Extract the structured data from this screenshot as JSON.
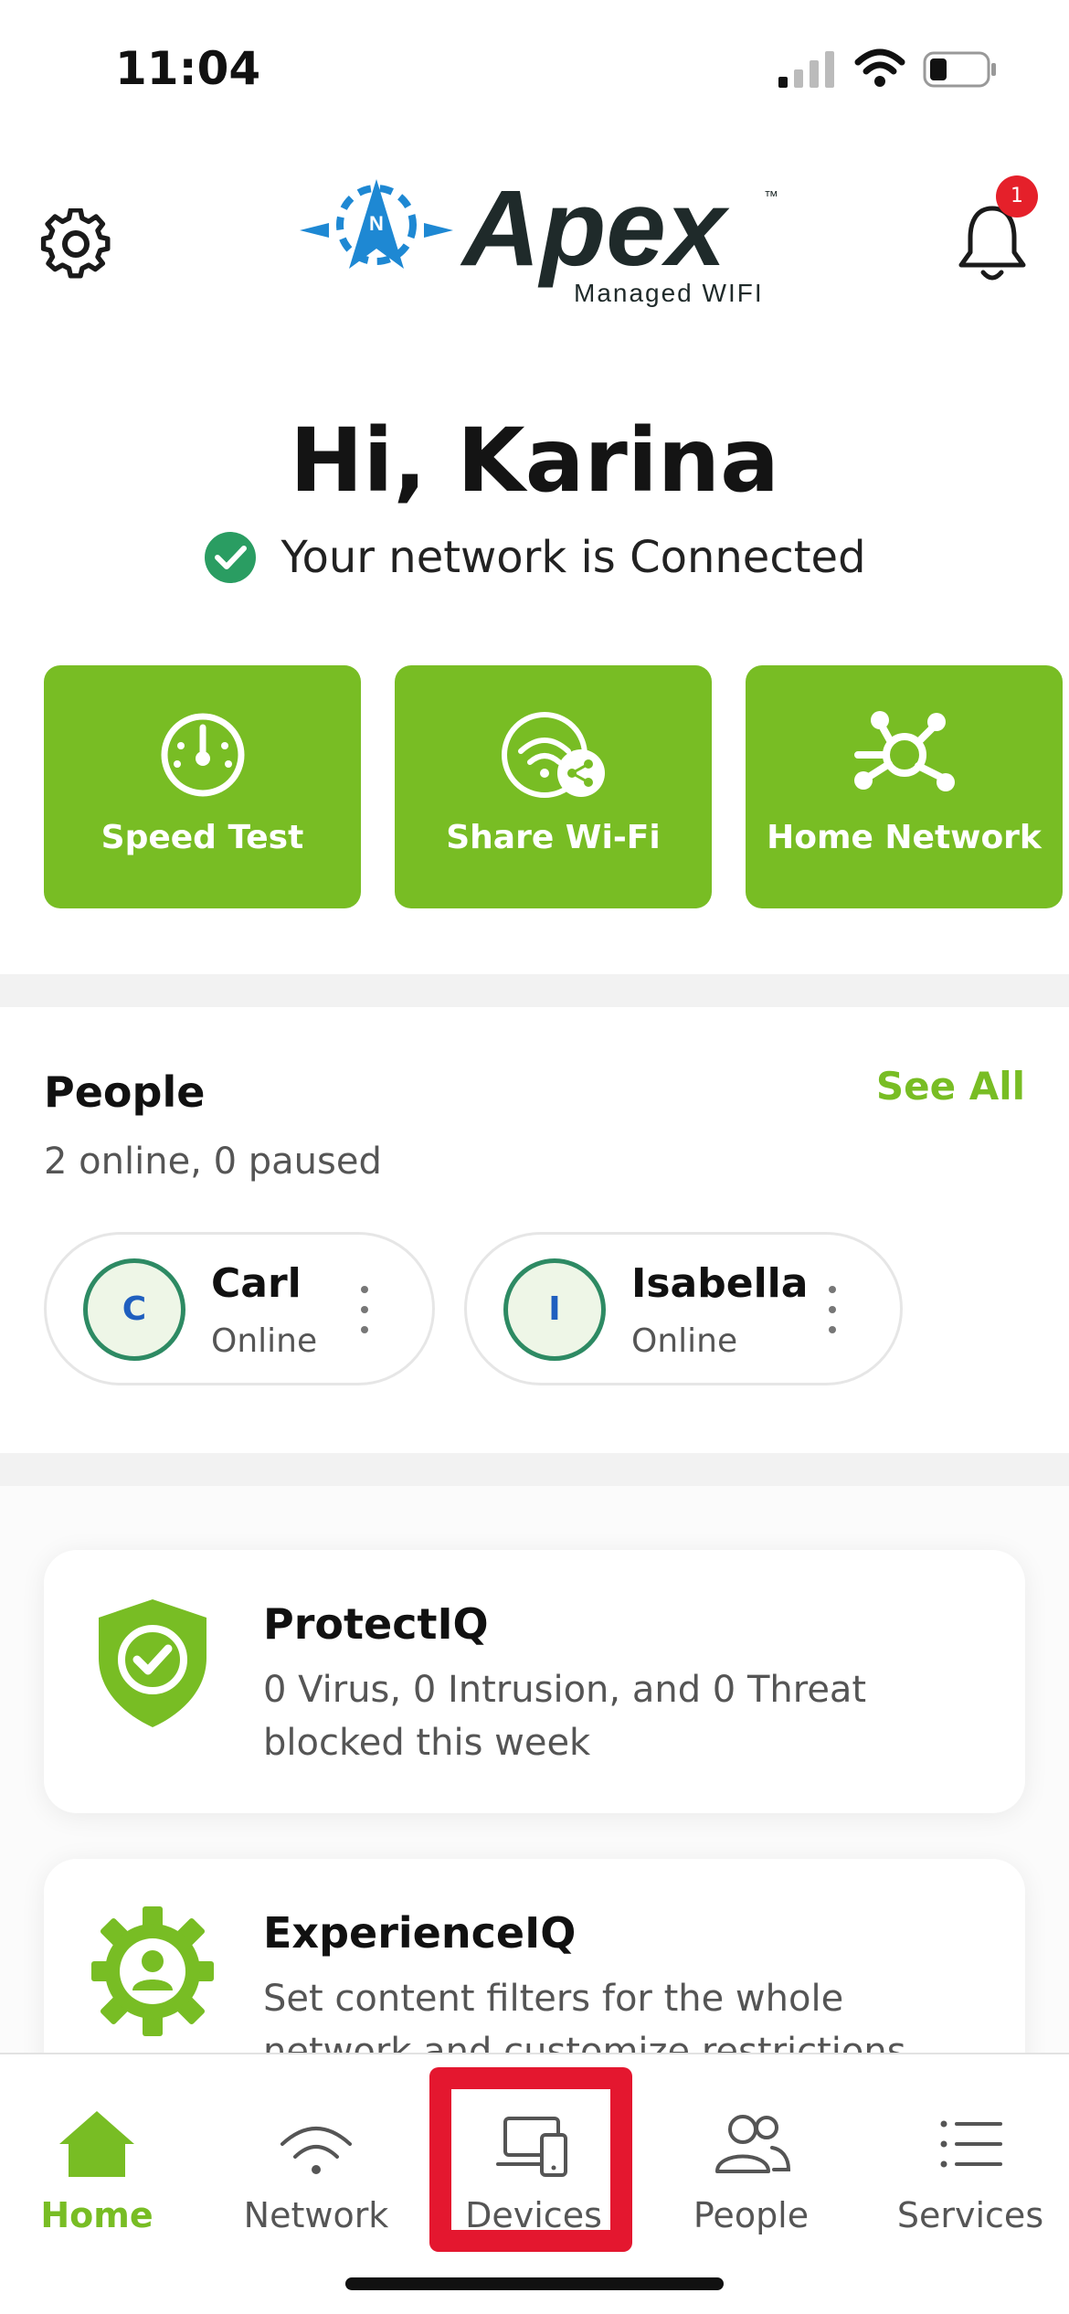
{
  "status_bar": {
    "time": "11:04"
  },
  "header": {
    "brand_name": "Apex",
    "brand_tagline": "Managed WIFI",
    "trademark": "™",
    "compass_letter": "N",
    "notification_count": "1"
  },
  "greeting": {
    "title": "Hi, Karina",
    "connection_text": "Your network is Connected"
  },
  "quick_actions": [
    {
      "label": "Speed Test",
      "icon": "speedometer-icon"
    },
    {
      "label": "Share Wi-Fi",
      "icon": "share-wifi-icon"
    },
    {
      "label": "Home Network",
      "icon": "network-hub-icon"
    }
  ],
  "people": {
    "title": "People",
    "see_all": "See All",
    "summary": "2 online, 0 paused",
    "members": [
      {
        "initial": "C",
        "name": "Carl",
        "status": "Online"
      },
      {
        "initial": "I",
        "name": "Isabella",
        "status": "Online"
      }
    ]
  },
  "cards": [
    {
      "title": "ProtectIQ",
      "description": "0 Virus, 0 Intrusion, and 0 Threat blocked this week",
      "icon": "shield-check-icon"
    },
    {
      "title": "ExperienceIQ",
      "description": "Set content filters for the whole network and customize restrictions and",
      "icon": "gear-person-icon"
    }
  ],
  "tabs": [
    {
      "label": "Home",
      "icon": "home-icon",
      "active": true
    },
    {
      "label": "Network",
      "icon": "wifi-icon",
      "active": false
    },
    {
      "label": "Devices",
      "icon": "devices-icon",
      "active": false
    },
    {
      "label": "People",
      "icon": "people-icon",
      "active": false
    },
    {
      "label": "Services",
      "icon": "list-icon",
      "active": false
    }
  ],
  "colors": {
    "accent_green": "#78bd24",
    "badge_red": "#e5202a",
    "logo_blue": "#1e88d3",
    "highlight_red": "#e4172f"
  }
}
